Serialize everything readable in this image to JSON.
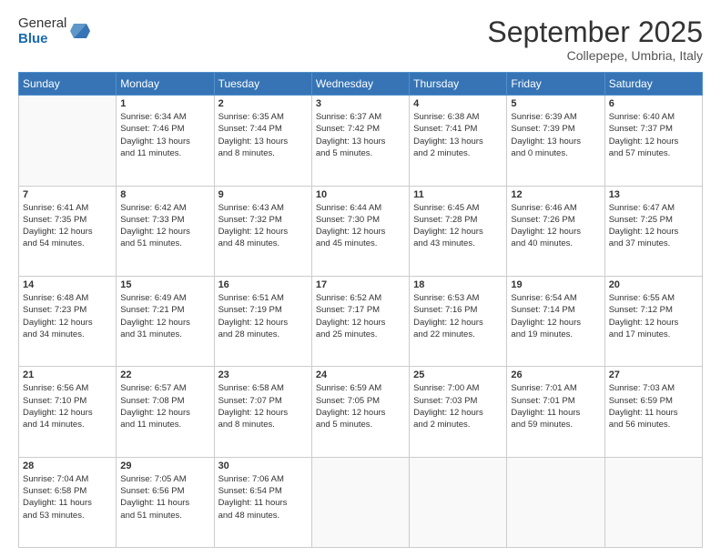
{
  "logo": {
    "general": "General",
    "blue": "Blue"
  },
  "header": {
    "month": "September 2025",
    "location": "Collepepe, Umbria, Italy"
  },
  "days_of_week": [
    "Sunday",
    "Monday",
    "Tuesday",
    "Wednesday",
    "Thursday",
    "Friday",
    "Saturday"
  ],
  "weeks": [
    [
      {
        "day": null,
        "data": null
      },
      {
        "day": "1",
        "data": [
          "Sunrise: 6:34 AM",
          "Sunset: 7:46 PM",
          "Daylight: 13 hours",
          "and 11 minutes."
        ]
      },
      {
        "day": "2",
        "data": [
          "Sunrise: 6:35 AM",
          "Sunset: 7:44 PM",
          "Daylight: 13 hours",
          "and 8 minutes."
        ]
      },
      {
        "day": "3",
        "data": [
          "Sunrise: 6:37 AM",
          "Sunset: 7:42 PM",
          "Daylight: 13 hours",
          "and 5 minutes."
        ]
      },
      {
        "day": "4",
        "data": [
          "Sunrise: 6:38 AM",
          "Sunset: 7:41 PM",
          "Daylight: 13 hours",
          "and 2 minutes."
        ]
      },
      {
        "day": "5",
        "data": [
          "Sunrise: 6:39 AM",
          "Sunset: 7:39 PM",
          "Daylight: 13 hours",
          "and 0 minutes."
        ]
      },
      {
        "day": "6",
        "data": [
          "Sunrise: 6:40 AM",
          "Sunset: 7:37 PM",
          "Daylight: 12 hours",
          "and 57 minutes."
        ]
      }
    ],
    [
      {
        "day": "7",
        "data": [
          "Sunrise: 6:41 AM",
          "Sunset: 7:35 PM",
          "Daylight: 12 hours",
          "and 54 minutes."
        ]
      },
      {
        "day": "8",
        "data": [
          "Sunrise: 6:42 AM",
          "Sunset: 7:33 PM",
          "Daylight: 12 hours",
          "and 51 minutes."
        ]
      },
      {
        "day": "9",
        "data": [
          "Sunrise: 6:43 AM",
          "Sunset: 7:32 PM",
          "Daylight: 12 hours",
          "and 48 minutes."
        ]
      },
      {
        "day": "10",
        "data": [
          "Sunrise: 6:44 AM",
          "Sunset: 7:30 PM",
          "Daylight: 12 hours",
          "and 45 minutes."
        ]
      },
      {
        "day": "11",
        "data": [
          "Sunrise: 6:45 AM",
          "Sunset: 7:28 PM",
          "Daylight: 12 hours",
          "and 43 minutes."
        ]
      },
      {
        "day": "12",
        "data": [
          "Sunrise: 6:46 AM",
          "Sunset: 7:26 PM",
          "Daylight: 12 hours",
          "and 40 minutes."
        ]
      },
      {
        "day": "13",
        "data": [
          "Sunrise: 6:47 AM",
          "Sunset: 7:25 PM",
          "Daylight: 12 hours",
          "and 37 minutes."
        ]
      }
    ],
    [
      {
        "day": "14",
        "data": [
          "Sunrise: 6:48 AM",
          "Sunset: 7:23 PM",
          "Daylight: 12 hours",
          "and 34 minutes."
        ]
      },
      {
        "day": "15",
        "data": [
          "Sunrise: 6:49 AM",
          "Sunset: 7:21 PM",
          "Daylight: 12 hours",
          "and 31 minutes."
        ]
      },
      {
        "day": "16",
        "data": [
          "Sunrise: 6:51 AM",
          "Sunset: 7:19 PM",
          "Daylight: 12 hours",
          "and 28 minutes."
        ]
      },
      {
        "day": "17",
        "data": [
          "Sunrise: 6:52 AM",
          "Sunset: 7:17 PM",
          "Daylight: 12 hours",
          "and 25 minutes."
        ]
      },
      {
        "day": "18",
        "data": [
          "Sunrise: 6:53 AM",
          "Sunset: 7:16 PM",
          "Daylight: 12 hours",
          "and 22 minutes."
        ]
      },
      {
        "day": "19",
        "data": [
          "Sunrise: 6:54 AM",
          "Sunset: 7:14 PM",
          "Daylight: 12 hours",
          "and 19 minutes."
        ]
      },
      {
        "day": "20",
        "data": [
          "Sunrise: 6:55 AM",
          "Sunset: 7:12 PM",
          "Daylight: 12 hours",
          "and 17 minutes."
        ]
      }
    ],
    [
      {
        "day": "21",
        "data": [
          "Sunrise: 6:56 AM",
          "Sunset: 7:10 PM",
          "Daylight: 12 hours",
          "and 14 minutes."
        ]
      },
      {
        "day": "22",
        "data": [
          "Sunrise: 6:57 AM",
          "Sunset: 7:08 PM",
          "Daylight: 12 hours",
          "and 11 minutes."
        ]
      },
      {
        "day": "23",
        "data": [
          "Sunrise: 6:58 AM",
          "Sunset: 7:07 PM",
          "Daylight: 12 hours",
          "and 8 minutes."
        ]
      },
      {
        "day": "24",
        "data": [
          "Sunrise: 6:59 AM",
          "Sunset: 7:05 PM",
          "Daylight: 12 hours",
          "and 5 minutes."
        ]
      },
      {
        "day": "25",
        "data": [
          "Sunrise: 7:00 AM",
          "Sunset: 7:03 PM",
          "Daylight: 12 hours",
          "and 2 minutes."
        ]
      },
      {
        "day": "26",
        "data": [
          "Sunrise: 7:01 AM",
          "Sunset: 7:01 PM",
          "Daylight: 11 hours",
          "and 59 minutes."
        ]
      },
      {
        "day": "27",
        "data": [
          "Sunrise: 7:03 AM",
          "Sunset: 6:59 PM",
          "Daylight: 11 hours",
          "and 56 minutes."
        ]
      }
    ],
    [
      {
        "day": "28",
        "data": [
          "Sunrise: 7:04 AM",
          "Sunset: 6:58 PM",
          "Daylight: 11 hours",
          "and 53 minutes."
        ]
      },
      {
        "day": "29",
        "data": [
          "Sunrise: 7:05 AM",
          "Sunset: 6:56 PM",
          "Daylight: 11 hours",
          "and 51 minutes."
        ]
      },
      {
        "day": "30",
        "data": [
          "Sunrise: 7:06 AM",
          "Sunset: 6:54 PM",
          "Daylight: 11 hours",
          "and 48 minutes."
        ]
      },
      {
        "day": null,
        "data": null
      },
      {
        "day": null,
        "data": null
      },
      {
        "day": null,
        "data": null
      },
      {
        "day": null,
        "data": null
      }
    ]
  ]
}
